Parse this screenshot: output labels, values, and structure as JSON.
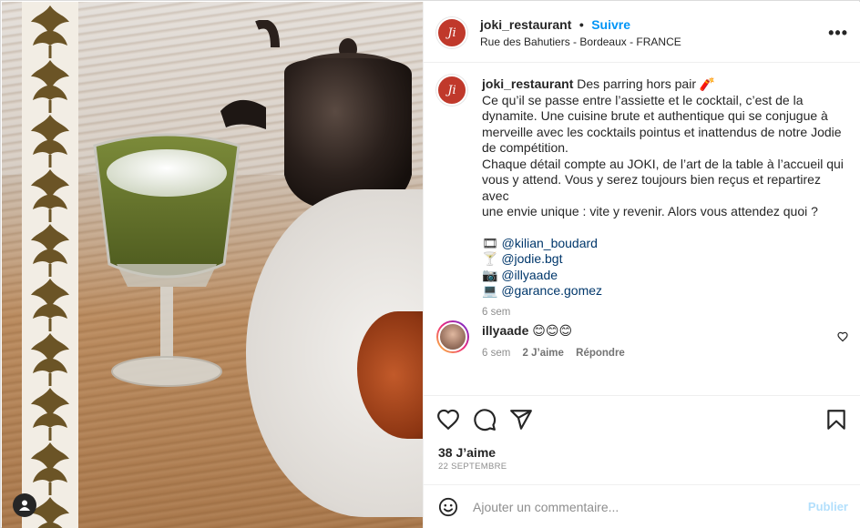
{
  "post": {
    "username": "joki_restaurant",
    "follow_label": "Suivre",
    "separator": "•",
    "location": "Rue des Bahutiers - Bordeaux - FRANCE",
    "more_label": "•••",
    "logo_initials": "Ji"
  },
  "caption": {
    "username": "joki_restaurant",
    "line1": "Des parring hors pair 🧨",
    "line2": "Ce qu’il se passe entre l’assiette et le cocktail, c’est de la",
    "line3": "dynamite. Une cuisine brute et authentique qui se conjugue à",
    "line4": "merveille avec les cocktails pointus et inattendus de notre Jodie",
    "line5": "de compétition.",
    "line6": "Chaque détail compte au JOKI, de l’art de la table à l’accueil qui",
    "line7": "vous y attend. Vous y serez toujours bien reçus et repartirez avec",
    "line8": "une envie unique : vite y revenir. Alors vous attendez quoi ?",
    "credits": [
      {
        "emoji": "🎞",
        "handle": "@kilian_boudard"
      },
      {
        "emoji": "🍸",
        "handle": "@jodie.bgt"
      },
      {
        "emoji": "📷",
        "handle": "@illyaade"
      },
      {
        "emoji": "💻",
        "handle": "@garance.gomez"
      }
    ],
    "time": "6 sem"
  },
  "comment": {
    "username": "illyaade",
    "text": "😊😊😊",
    "time": "6 sem",
    "likes": "2 J’aime",
    "reply": "Répondre"
  },
  "engagement": {
    "likes": "38 J’aime",
    "date": "22 SEPTEMBRE"
  },
  "composer": {
    "placeholder": "Ajouter un commentaire...",
    "publish_label": "Publier"
  },
  "colors": {
    "accent": "#0095f6",
    "brand": "#c0392b",
    "mention": "#00376b",
    "muted": "#8e8e8e"
  },
  "icons": [
    "heart-icon",
    "comment-icon",
    "share-icon",
    "bookmark-icon",
    "emoji-icon",
    "more-icon",
    "user-icon",
    "comment-heart-icon"
  ]
}
